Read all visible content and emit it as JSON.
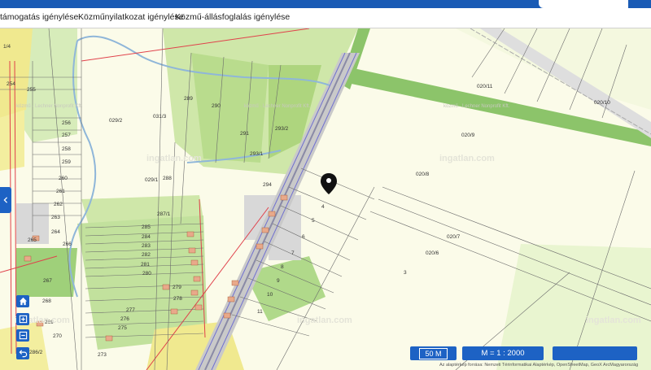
{
  "tabs": [
    {
      "label": "támogatás igénylése"
    },
    {
      "label": "Közműnyilatkozat igénylése"
    },
    {
      "label": "Közmű-állásfoglalás igénylése"
    }
  ],
  "map": {
    "parcels": [
      "1/4",
      "254",
      "255",
      "256",
      "257",
      "258",
      "259",
      "260",
      "261",
      "262",
      "263",
      "264",
      "265",
      "266",
      "267",
      "268",
      "269",
      "270",
      "273",
      "275",
      "276",
      "277",
      "278",
      "279",
      "280",
      "281",
      "282",
      "283",
      "284",
      "285",
      "286/2",
      "287/1",
      "288",
      "289",
      "290",
      "291",
      "293/2",
      "293/1",
      "294",
      "029/1",
      "029/2",
      "031/3",
      "020/11",
      "020/10",
      "020/9",
      "020/8",
      "020/7",
      "020/6",
      "3",
      "4",
      "5",
      "6",
      "7",
      "8",
      "9",
      "10",
      "11"
    ],
    "watermarks": [
      "ingatlan.com",
      "ingatlan.com",
      "ingatlan.com",
      "ingatlan.com",
      "ingatlan.com"
    ],
    "company_marks": [
      "közmű · Lechner Nonprofit Kft.",
      "közmű · Lechner Nonprofit Kft.",
      "közmű · Lechner Nonprofit Kft."
    ]
  },
  "controls": {
    "scale_label": "50 M",
    "ratio_label": "M = 1 : 2000",
    "empty_button": ""
  },
  "attribution": "Az alaptérkép forrása: Nemzeti Térinformatikai Alaptérkép, OpenStreetMap, GeoX ArcMagyarország"
}
